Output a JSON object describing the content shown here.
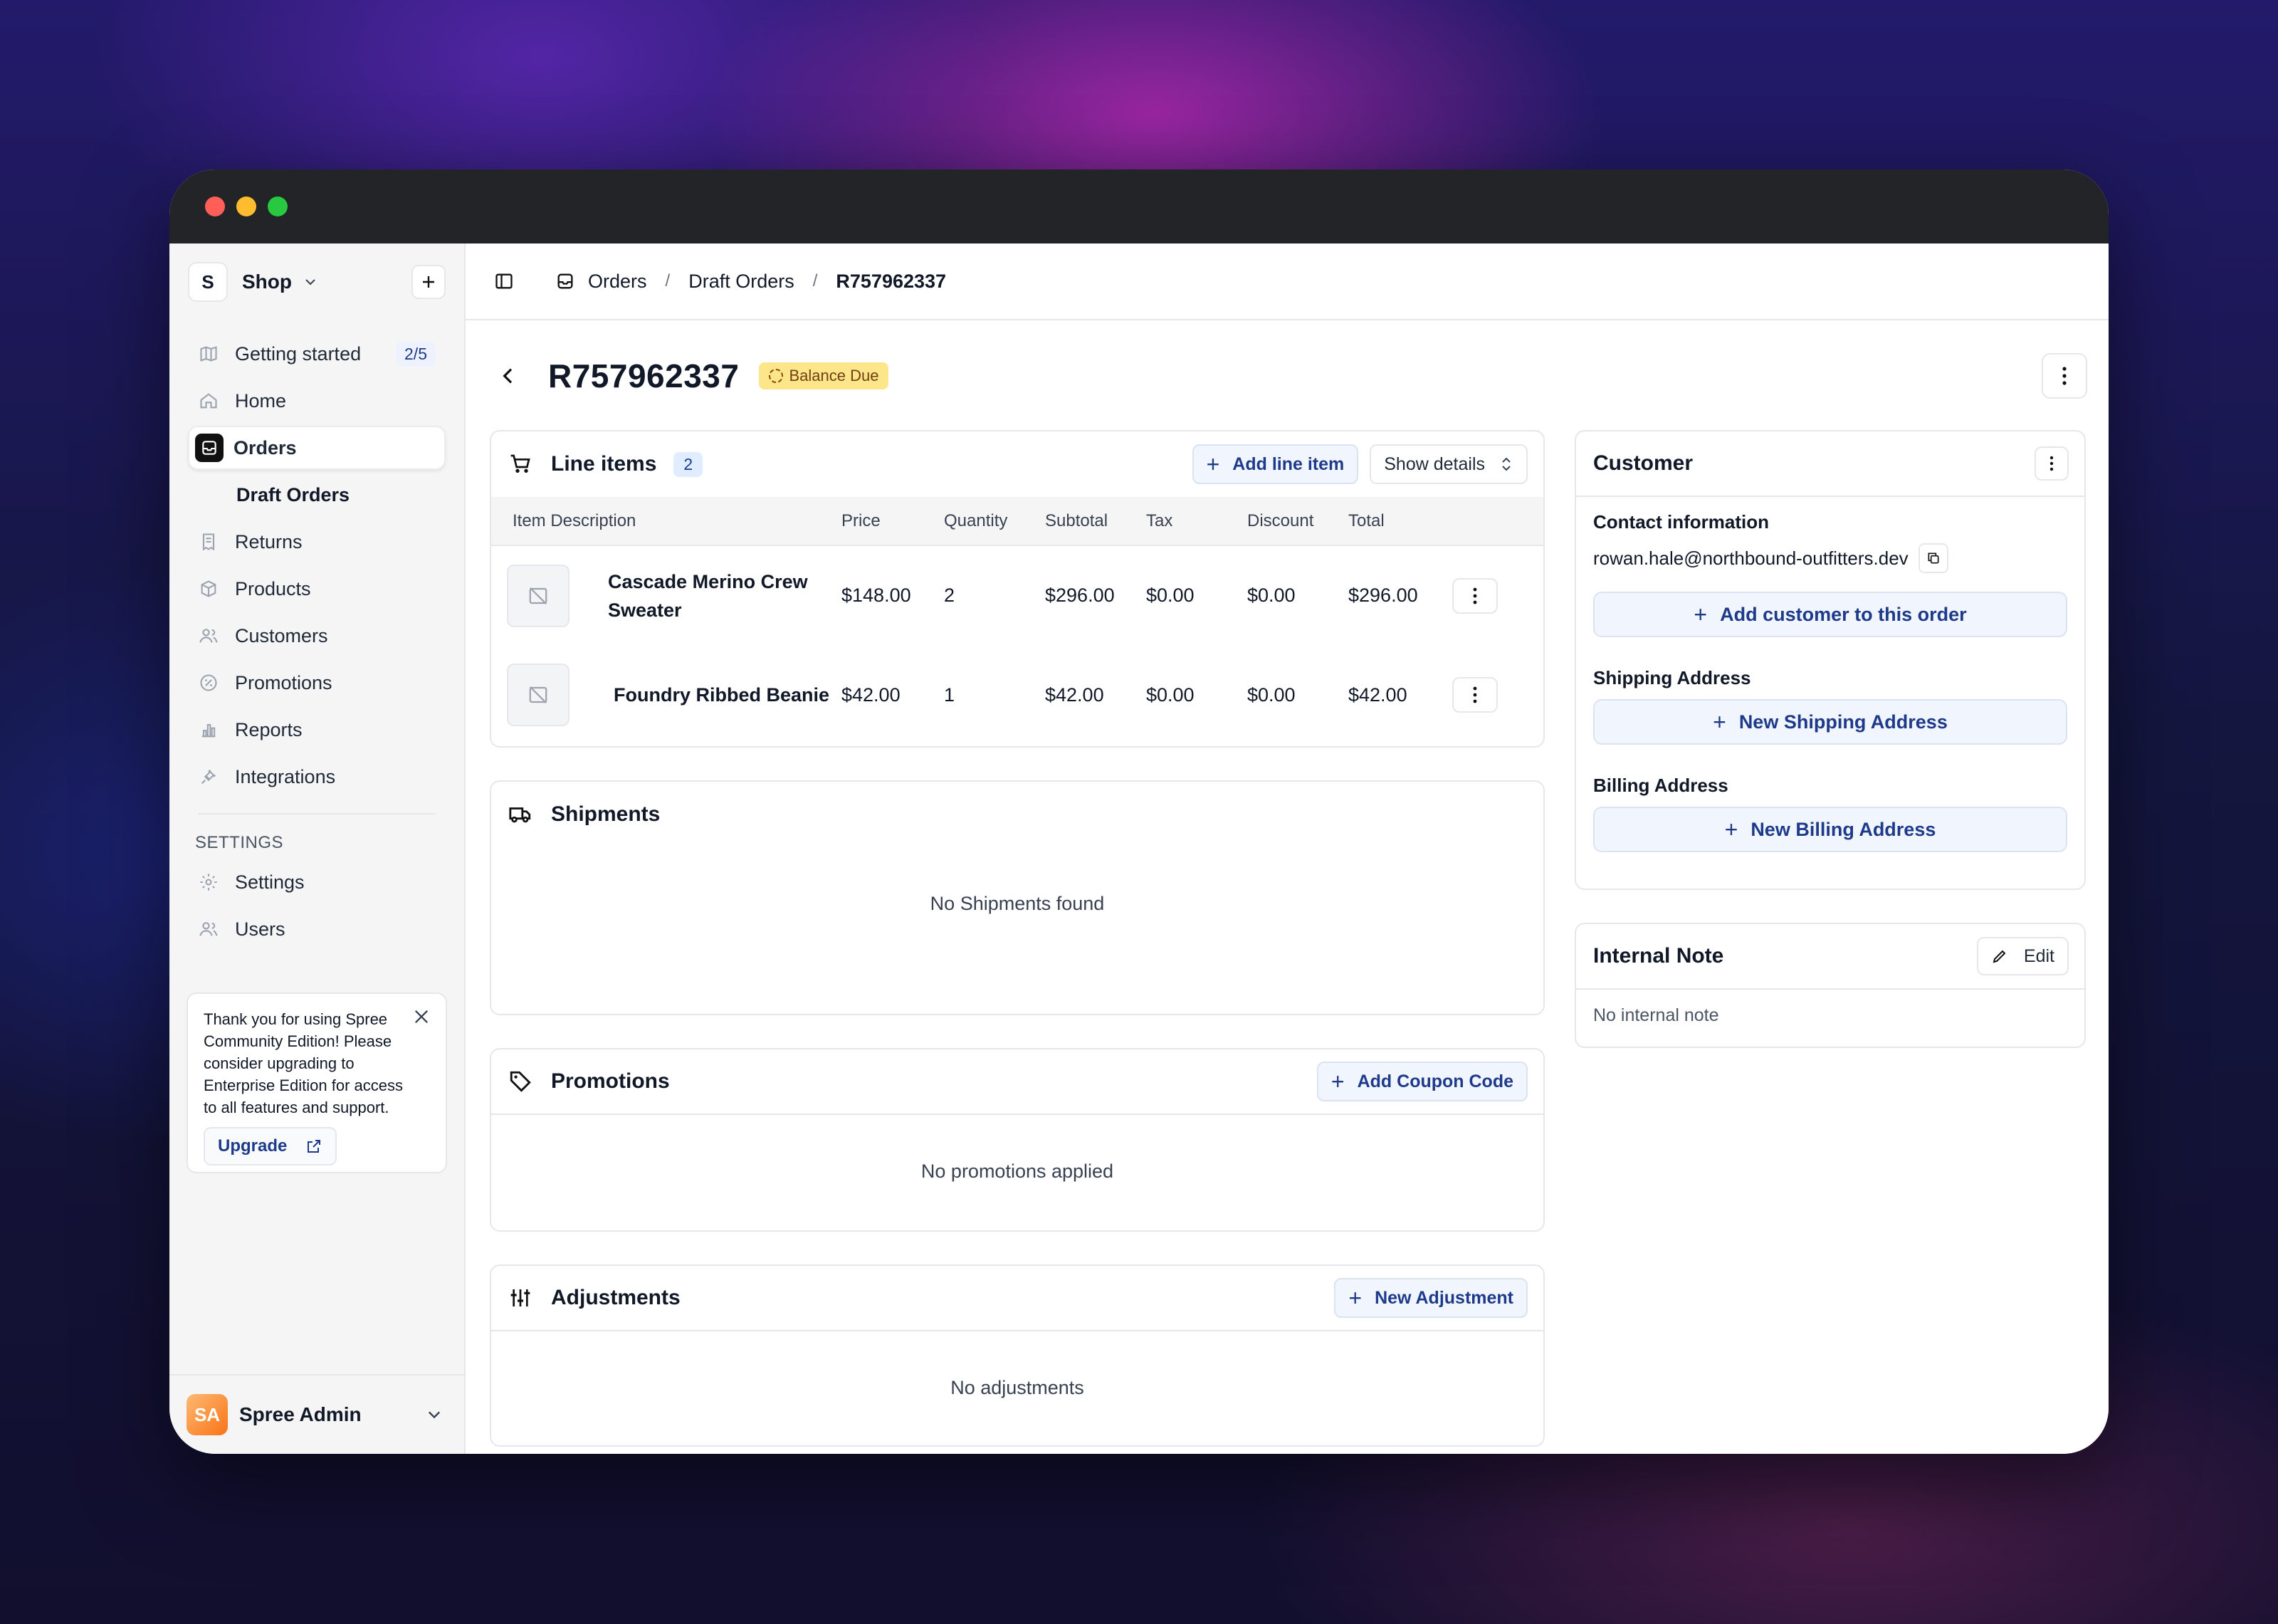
{
  "sidebar": {
    "store": {
      "initial": "S",
      "name": "Shop"
    },
    "nav": [
      {
        "label": "Getting started",
        "icon": "map-icon",
        "badge": "2/5"
      },
      {
        "label": "Home",
        "icon": "home-icon"
      },
      {
        "label": "Orders",
        "icon": "inbox-icon"
      },
      {
        "label": "Draft Orders"
      },
      {
        "label": "Returns",
        "icon": "receipt-icon"
      },
      {
        "label": "Products",
        "icon": "package-icon"
      },
      {
        "label": "Customers",
        "icon": "users-icon"
      },
      {
        "label": "Promotions",
        "icon": "discount-icon"
      },
      {
        "label": "Reports",
        "icon": "chart-icon"
      },
      {
        "label": "Integrations",
        "icon": "plug-icon"
      }
    ],
    "settings_label": "SETTINGS",
    "settings": [
      {
        "label": "Settings",
        "icon": "gear-icon"
      },
      {
        "label": "Users",
        "icon": "users-icon"
      }
    ],
    "notice": {
      "text": "Thank you for using Spree Community Edition! Please consider upgrading to Enterprise Edition for access to all features and support.",
      "upgrade_label": "Upgrade"
    },
    "user": {
      "initials": "SA",
      "name": "Spree Admin"
    }
  },
  "breadcrumbs": [
    "Orders",
    "Draft Orders",
    "R757962337"
  ],
  "order": {
    "number": "R757962337",
    "status": "Balance Due"
  },
  "line_items": {
    "title": "Line items",
    "count": "2",
    "add_label": "Add line item",
    "details_label": "Show details",
    "columns": [
      "Item Description",
      "Price",
      "Quantity",
      "Subtotal",
      "Tax",
      "Discount",
      "Total"
    ],
    "rows": [
      {
        "name": "Cascade Merino Crew Sweater",
        "price": "$148.00",
        "quantity": "2",
        "subtotal": "$296.00",
        "tax": "$0.00",
        "discount": "$0.00",
        "total": "$296.00"
      },
      {
        "name": "Foundry Ribbed Beanie",
        "price": "$42.00",
        "quantity": "1",
        "subtotal": "$42.00",
        "tax": "$0.00",
        "discount": "$0.00",
        "total": "$42.00"
      }
    ]
  },
  "shipments": {
    "title": "Shipments",
    "empty": "No Shipments found"
  },
  "promotions": {
    "title": "Promotions",
    "add_label": "Add Coupon Code",
    "empty": "No promotions applied"
  },
  "adjustments": {
    "title": "Adjustments",
    "add_label": "New Adjustment",
    "empty": "No adjustments"
  },
  "customer": {
    "title": "Customer",
    "contact_label": "Contact information",
    "email": "rowan.hale@northbound-outfitters.dev",
    "add_customer_label": "Add customer to this order",
    "shipping_label": "Shipping Address",
    "new_shipping_label": "New Shipping Address",
    "billing_label": "Billing Address",
    "new_billing_label": "New Billing Address"
  },
  "internal_note": {
    "title": "Internal Note",
    "edit_label": "Edit",
    "empty": "No internal note"
  },
  "colors": {
    "accent": "#1e3a8a",
    "status_badge": "#fde68a",
    "soft_button": "#f1f5fd"
  }
}
